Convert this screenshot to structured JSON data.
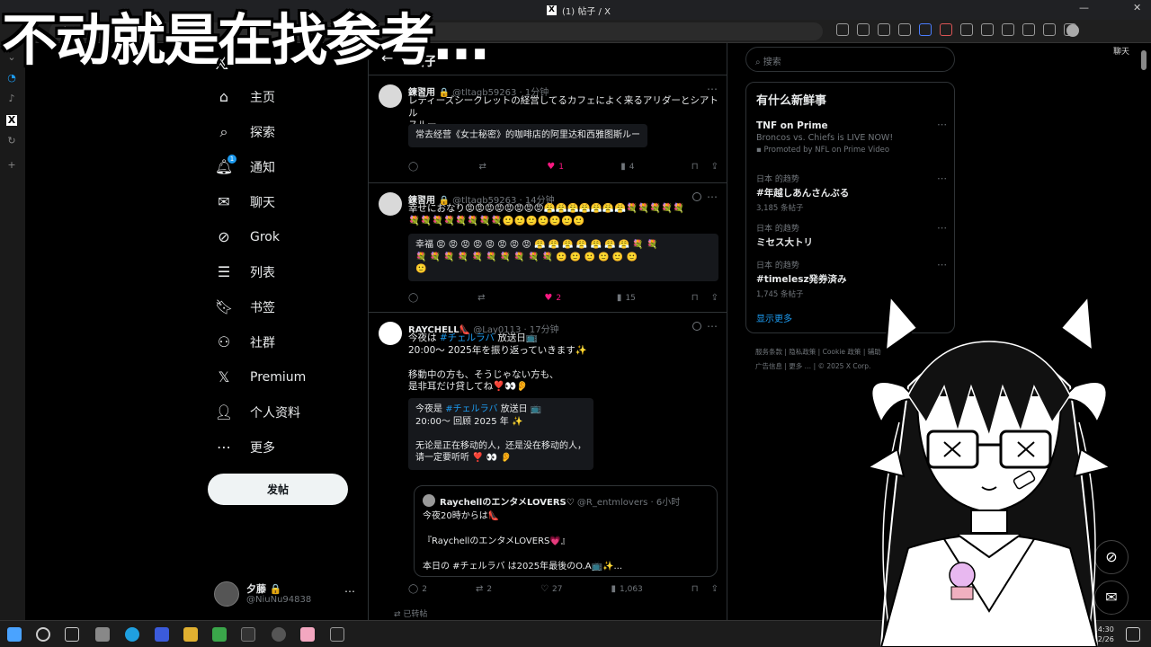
{
  "caption": "不动就是在找参考…",
  "browser": {
    "tab_title": "(1) 帖子 / X",
    "address": "https://x.com/i/timeline",
    "copilot_label": "聊天"
  },
  "nav": {
    "items": [
      {
        "label": "主页",
        "icon": "home-icon"
      },
      {
        "label": "探索",
        "icon": "search-icon"
      },
      {
        "label": "通知",
        "icon": "bell-icon",
        "badge": "1"
      },
      {
        "label": "聊天",
        "icon": "mail-icon"
      },
      {
        "label": "Grok",
        "icon": "grok-icon"
      },
      {
        "label": "列表",
        "icon": "list-icon"
      },
      {
        "label": "书签",
        "icon": "bookmark-icon"
      },
      {
        "label": "社群",
        "icon": "community-icon"
      },
      {
        "label": "Premium",
        "icon": "x-premium-icon"
      },
      {
        "label": "个人资料",
        "icon": "profile-icon"
      },
      {
        "label": "更多",
        "icon": "more-circle-icon"
      }
    ],
    "post_button": "发帖"
  },
  "account": {
    "name": "夕藤 🔒",
    "handle": "@NiuNu94838"
  },
  "timeline": {
    "header_title": "帖子",
    "tweets": [
      {
        "name": "鍊習用 🔒",
        "meta": "@tltagb59263 · 1分钟",
        "text": "レディーズシークレットの経営してるカフェによく来るアリダーとシアトル\nスルー",
        "translation": "常去经营《女士秘密》的咖啡店的阿里达和西雅图斯ルー",
        "reply": "",
        "retweet": "",
        "like": "1",
        "views": "4"
      },
      {
        "name": "鍊習用 🔒",
        "meta": "@tltagb59263 · 14分钟",
        "text": "幸せにおなり😡😡😡😡😡😡😡😡😤😤😤😤😤😤😤💐💐💐💐💐\n💐💐💐💐💐💐💐💐🙂🙂🙂🙂🙂🙂🙂",
        "translation": "幸福 😡 😡 😡 😡 😡 😡 😡 😡 😤 😤 😤 😤 😤 😤 😤 💐 💐\n💐 💐 💐 💐 💐 💐 💐 💐 💐 💐 🙂 🙂 🙂 🙂 🙂 🙂\n🙂",
        "reply": "",
        "retweet": "",
        "like": "2",
        "views": "15"
      },
      {
        "name": "RAYCHELL👠",
        "meta": "@Lay0113 · 17分钟",
        "text_pre": "今夜は ",
        "text_tag": "#チェルラバ",
        "text_post": " 放送日📺\n20:00〜 2025年を振り返っていきます✨\n\n移動中の方も、そうじゃない方も、\n是非耳だけ貸してね❣️👀👂",
        "translation_pre": "今夜是 ",
        "translation_tag": "#チェルラバ",
        "translation_post": " 放送日 📺\n20:00〜 回顾 2025 年 ✨\n\n无论是正在移动的人，还是没在移动的人，\n请一定要听听 ❣️ 👀 👂",
        "quote": {
          "name": "RaychellのエンタメLOVERS♡",
          "meta": "@R_entmlovers · 6小时",
          "text": "今夜20時からは👠\n\n『RaychellのエンタメLOVERS💗』\n\n本日の #チェルラバ は2025年最後のO.A📺✨..."
        },
        "reply": "2",
        "retweet": "2",
        "like": "27",
        "views": "1,063"
      }
    ],
    "retweeted_label": "已转帖"
  },
  "right": {
    "search_placeholder": "搜索",
    "trends_title": "有什么新鲜事",
    "trends": [
      {
        "context": "",
        "name": "TNF on Prime",
        "sub": "Broncos vs. Chiefs is LIVE NOW!",
        "count": "Promoted by NFL on Prime Video"
      },
      {
        "context": "日本 的趋势",
        "name": "#年越しあんさんぶる",
        "sub": "",
        "count": "3,185 条帖子"
      },
      {
        "context": "日本 的趋势",
        "name": "ミセス大トリ",
        "sub": "",
        "count": ""
      },
      {
        "context": "日本 的趋势",
        "name": "#timelesz発券済み",
        "sub": "",
        "count": "1,745 条帖子"
      }
    ],
    "show_more": "显示更多",
    "footer_line1": "服务条款 | 隐私政策 | Cookie 政策 | 辅助",
    "footer_line2": "广告信息 | 更多 … | © 2025 X Corp."
  },
  "taskbar": {
    "time": "14:30",
    "date": "5/12/26"
  }
}
